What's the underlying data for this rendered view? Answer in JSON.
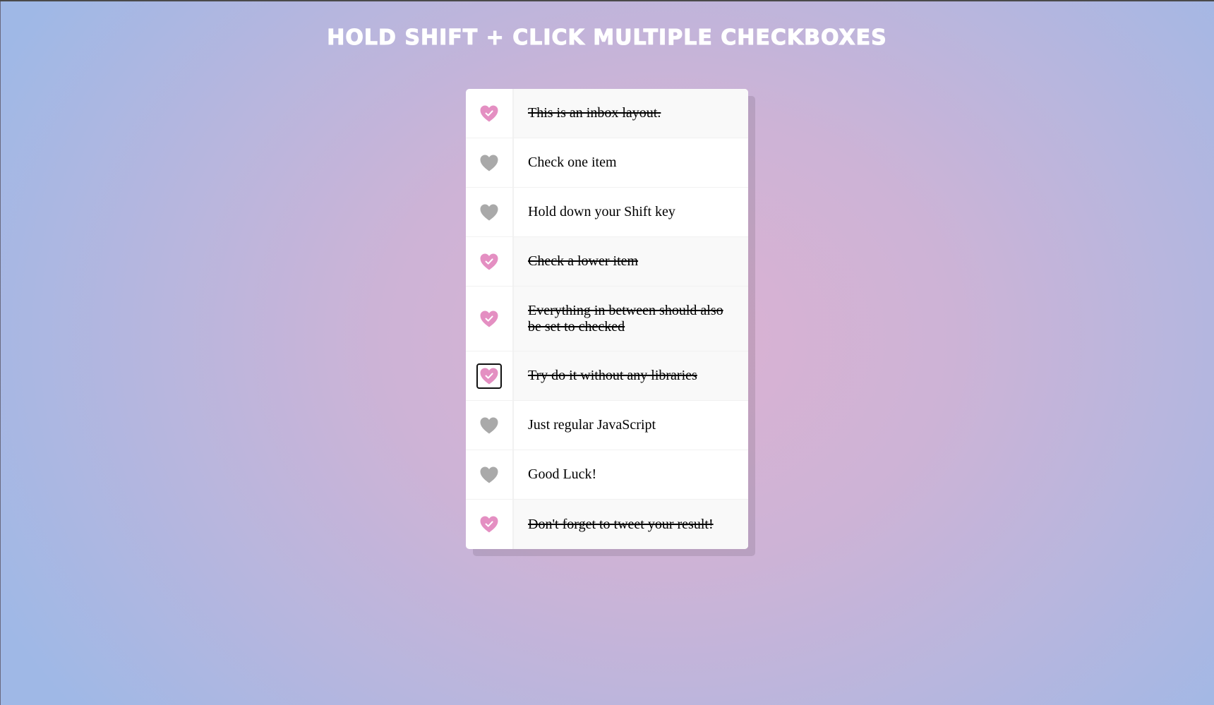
{
  "page": {
    "title": "HOLD SHIFT + CLICK MULTIPLE CHECKBOXES"
  },
  "colors": {
    "heart_checked": "#e48fc2",
    "heart_unchecked": "#a9a9a9",
    "check_mark": "#ffffff"
  },
  "inbox": {
    "items": [
      {
        "label": "This is an inbox layout.",
        "checked": true,
        "focused": false
      },
      {
        "label": "Check one item",
        "checked": false,
        "focused": false
      },
      {
        "label": "Hold down your Shift key",
        "checked": false,
        "focused": false
      },
      {
        "label": "Check a lower item",
        "checked": true,
        "focused": false
      },
      {
        "label": "Everything in between should also be set to checked",
        "checked": true,
        "focused": false
      },
      {
        "label": "Try do it without any libraries",
        "checked": true,
        "focused": true
      },
      {
        "label": "Just regular JavaScript",
        "checked": false,
        "focused": false
      },
      {
        "label": "Good Luck!",
        "checked": false,
        "focused": false
      },
      {
        "label": "Don't forget to tweet your result!",
        "checked": true,
        "focused": false
      }
    ]
  }
}
